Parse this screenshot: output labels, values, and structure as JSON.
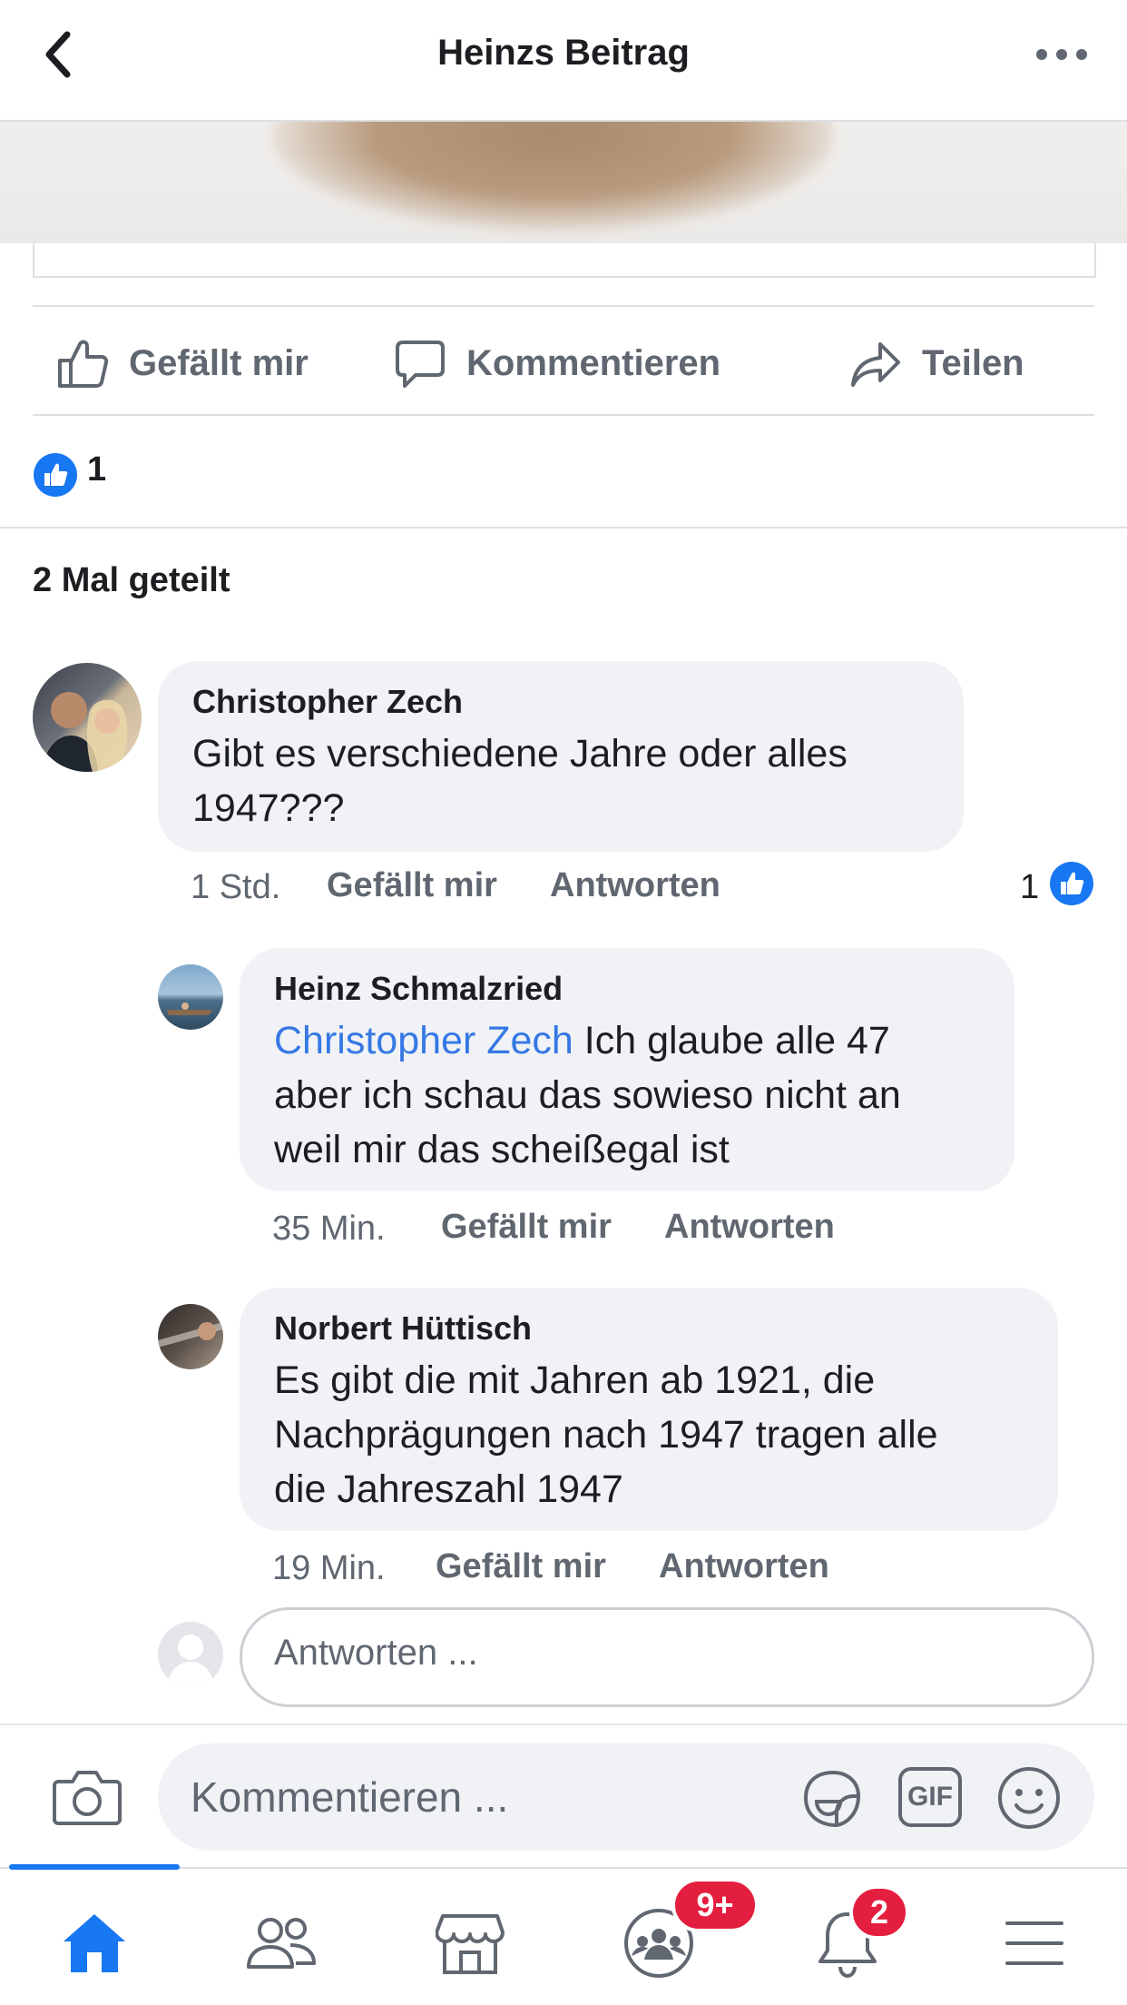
{
  "header": {
    "title": "Heinzs Beitrag"
  },
  "actions": {
    "like": "Gefällt mir",
    "comment": "Kommentieren",
    "share": "Teilen"
  },
  "post": {
    "reaction_count": "1",
    "shares": "2 Mal geteilt"
  },
  "comments": [
    {
      "author": "Christopher Zech",
      "lines": [
        "Gibt es verschiedene Jahre oder alles",
        "1947???"
      ],
      "time": "1 Std.",
      "like": "Gefällt mir",
      "reply": "Antworten",
      "reactions": "1"
    }
  ],
  "replies": [
    {
      "author": "Heinz Schmalzried",
      "mention": "Christopher Zech",
      "lines": [
        " Ich glaube alle 47",
        "aber ich schau das sowieso nicht an",
        "weil mir das scheißegal ist"
      ],
      "time": "35 Min.",
      "like": "Gefällt mir",
      "reply": "Antworten"
    },
    {
      "author": "Norbert Hüttisch",
      "lines": [
        "Es gibt die mit Jahren ab 1921, die",
        "Nachprägungen nach 1947 tragen alle",
        "die Jahreszahl 1947"
      ],
      "time": "19 Min.",
      "like": "Gefällt mir",
      "reply": "Antworten"
    }
  ],
  "reply_box": {
    "placeholder": "Antworten ..."
  },
  "composer": {
    "placeholder": "Kommentieren ...",
    "gif": "GIF"
  },
  "tabbar": {
    "groups_badge": "9+",
    "notifications_badge": "2",
    "active_color": "#1877f2"
  }
}
